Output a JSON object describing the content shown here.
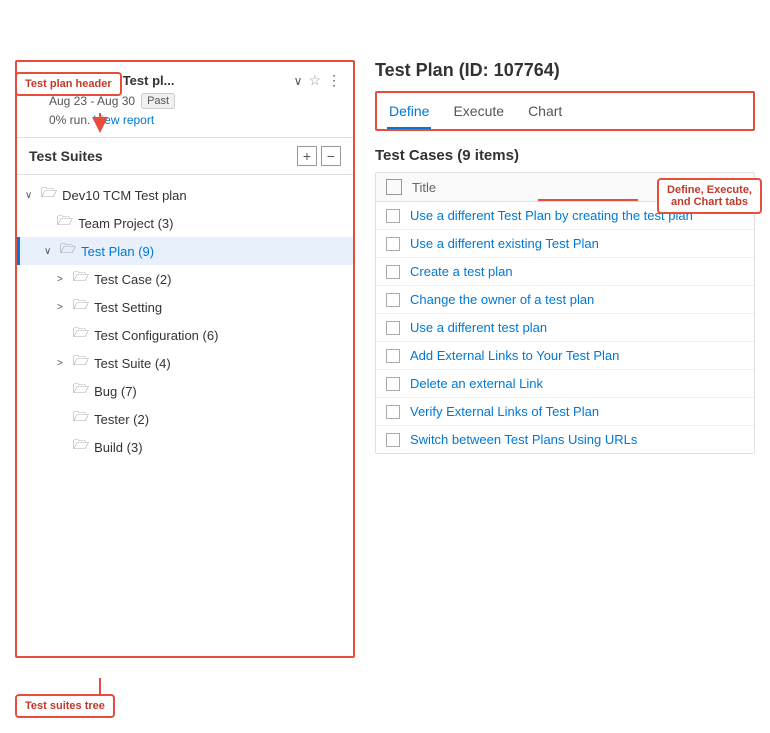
{
  "annotations": {
    "test_plan_header_label": "Test plan header",
    "test_suites_tree_label": "Test suites tree",
    "tabs_label": "Define, Execute,\nand Chart tabs"
  },
  "left_panel": {
    "header": {
      "back_arrow": "←",
      "title": "Dev10 TCM Test pl...",
      "dropdown": "∨",
      "star": "☆",
      "more": "⋮",
      "date_range": "Aug 23 - Aug 30",
      "badge": "Past",
      "run_percent": "0% run.",
      "view_report": "View report"
    },
    "test_suites": {
      "title": "Test Suites",
      "add_btn": "+",
      "collapse_btn": "−",
      "tree": [
        {
          "indent": 0,
          "has_chevron": true,
          "chevron": "∨",
          "has_folder": true,
          "text": "Dev10 TCM Test plan",
          "selected": false
        },
        {
          "indent": 1,
          "has_chevron": false,
          "chevron": "",
          "has_folder": true,
          "text": "Team Project (3)",
          "selected": false
        },
        {
          "indent": 1,
          "has_chevron": true,
          "chevron": "∨",
          "has_folder": true,
          "text": "Test Plan (9)",
          "selected": true
        },
        {
          "indent": 2,
          "has_chevron": true,
          "chevron": ">",
          "has_folder": true,
          "text": "Test Case (2)",
          "selected": false
        },
        {
          "indent": 2,
          "has_chevron": true,
          "chevron": ">",
          "has_folder": true,
          "text": "Test Setting",
          "selected": false
        },
        {
          "indent": 2,
          "has_chevron": false,
          "chevron": "",
          "has_folder": true,
          "text": "Test Configuration (6)",
          "selected": false
        },
        {
          "indent": 2,
          "has_chevron": true,
          "chevron": ">",
          "has_folder": true,
          "text": "Test Suite (4)",
          "selected": false
        },
        {
          "indent": 2,
          "has_chevron": false,
          "chevron": "",
          "has_folder": true,
          "text": "Bug (7)",
          "selected": false
        },
        {
          "indent": 2,
          "has_chevron": false,
          "chevron": "",
          "has_folder": true,
          "text": "Tester (2)",
          "selected": false
        },
        {
          "indent": 2,
          "has_chevron": false,
          "chevron": "",
          "has_folder": true,
          "text": "Build (3)",
          "selected": false
        }
      ]
    }
  },
  "right_panel": {
    "title": "Test Plan (ID: 107764)",
    "tabs": [
      {
        "label": "Define",
        "active": true
      },
      {
        "label": "Execute",
        "active": false
      },
      {
        "label": "Chart",
        "active": false
      }
    ],
    "test_cases": {
      "title": "Test Cases (9 items)",
      "header_label": "Title",
      "items": [
        {
          "text": "Use a different Test Plan by creating the test plan"
        },
        {
          "text": "Use a different existing Test Plan"
        },
        {
          "text": "Create a test plan"
        },
        {
          "text": "Change the owner of a test plan"
        },
        {
          "text": "Use a different test plan"
        },
        {
          "text": "Add External Links to Your Test Plan"
        },
        {
          "text": "Delete an external Link"
        },
        {
          "text": "Verify External Links of Test Plan"
        },
        {
          "text": "Switch between Test Plans Using URLs"
        }
      ]
    }
  }
}
